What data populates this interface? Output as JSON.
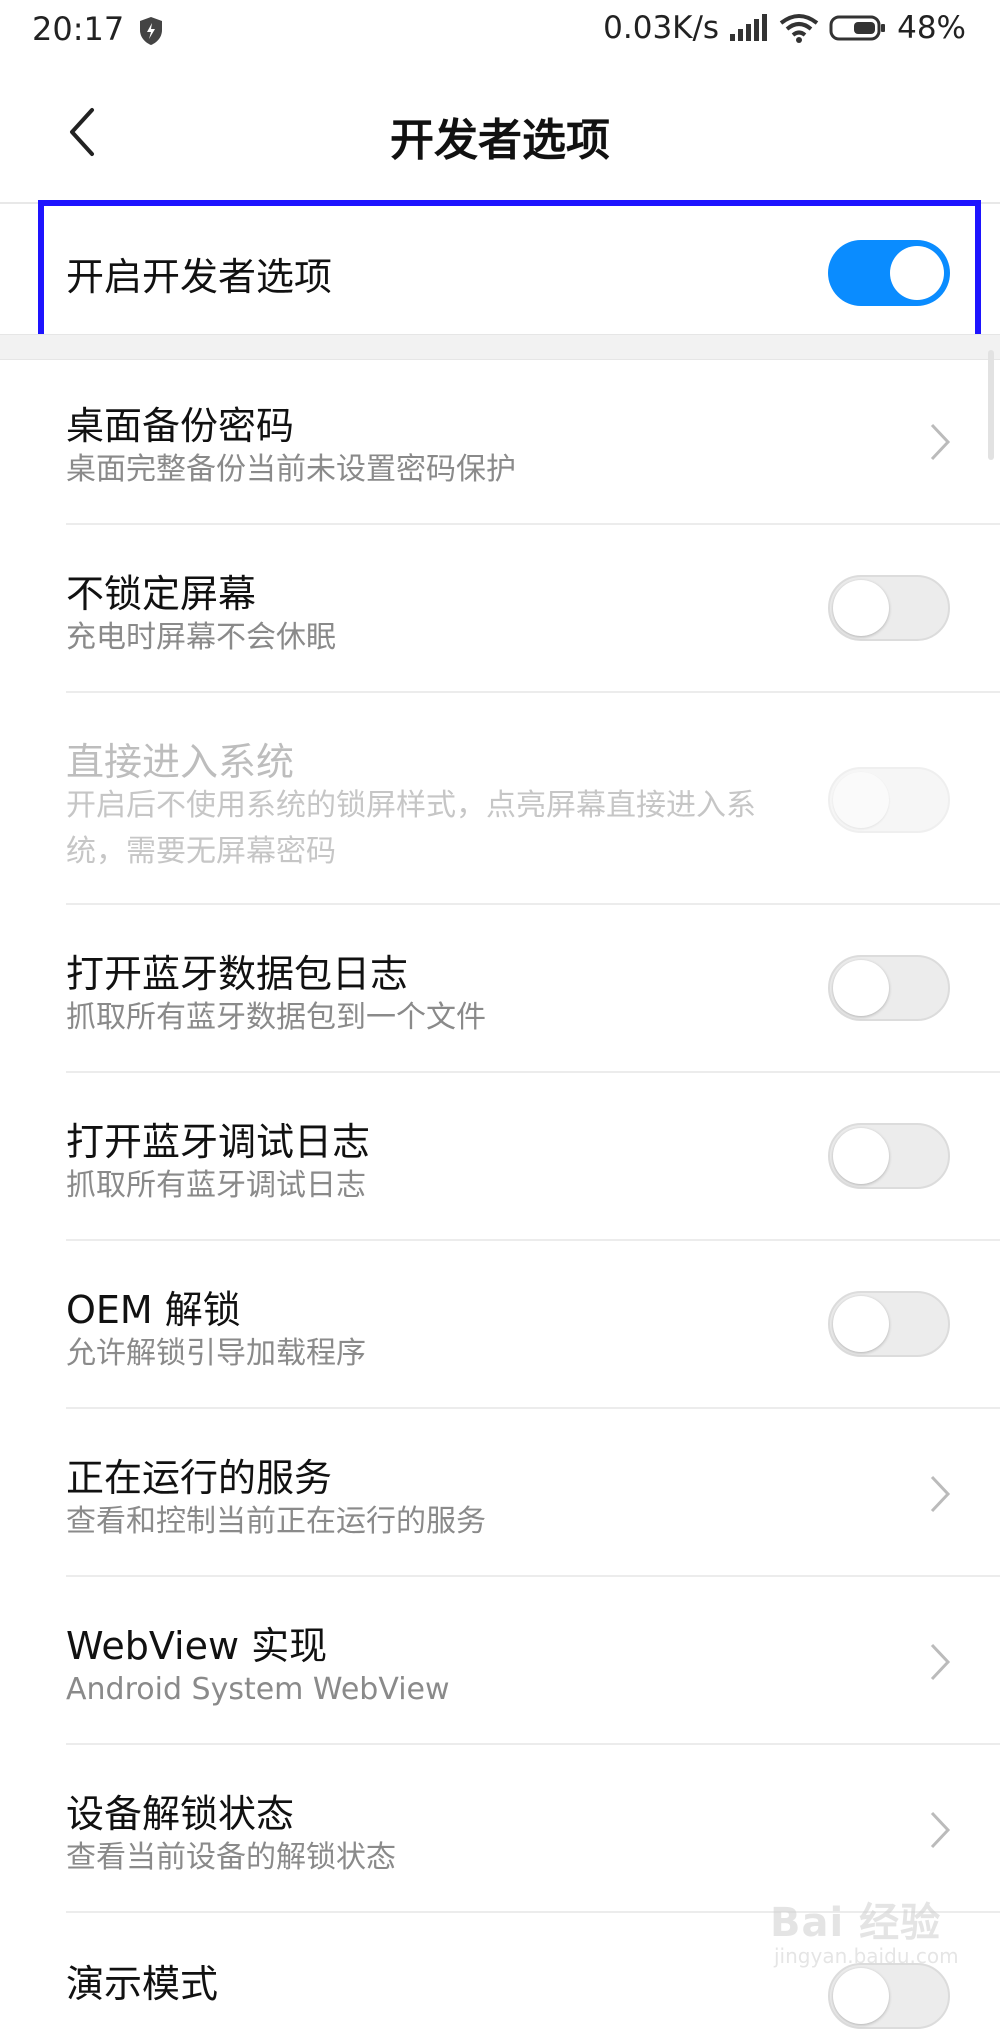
{
  "status_bar": {
    "time": "20:17",
    "net_speed": "0.03K/s",
    "battery": "48%",
    "icons": [
      "shield-icon",
      "signal-icon",
      "wifi-icon",
      "battery-icon"
    ]
  },
  "header": {
    "title": "开发者选项",
    "back_icon": "back-chevron-icon"
  },
  "master": {
    "label": "开启开发者选项",
    "enabled": true
  },
  "items": [
    {
      "title": "桌面备份密码",
      "subtitle": "桌面完整备份当前未设置密码保护",
      "control": "chevron"
    },
    {
      "title": "不锁定屏幕",
      "subtitle": "充电时屏幕不会休眠",
      "control": "toggle",
      "checked": false
    },
    {
      "title": "直接进入系统",
      "subtitle": "开启后不使用系统的锁屏样式，点亮屏幕直接进入系统，需要无屏幕密码",
      "control": "toggle",
      "checked": false,
      "disabled": true
    },
    {
      "title": "打开蓝牙数据包日志",
      "subtitle": "抓取所有蓝牙数据包到一个文件",
      "control": "toggle",
      "checked": false
    },
    {
      "title": "打开蓝牙调试日志",
      "subtitle": "抓取所有蓝牙调试日志",
      "control": "toggle",
      "checked": false
    },
    {
      "title": "OEM 解锁",
      "subtitle": "允许解锁引导加载程序",
      "control": "toggle",
      "checked": false
    },
    {
      "title": "正在运行的服务",
      "subtitle": "查看和控制当前正在运行的服务",
      "control": "chevron"
    },
    {
      "title": "WebView 实现",
      "subtitle": "Android System WebView",
      "control": "chevron"
    },
    {
      "title": "设备解锁状态",
      "subtitle": "查看当前设备的解锁状态",
      "control": "chevron"
    },
    {
      "title": "演示模式",
      "subtitle": "",
      "control": "toggle",
      "checked": false
    }
  ],
  "watermark": {
    "text": "Bai 经验",
    "sub": "jingyan.baidu.com"
  },
  "colors": {
    "accent": "#0a8cff",
    "highlight": "#1e14ff",
    "subtitle": "#8a8a8a"
  }
}
